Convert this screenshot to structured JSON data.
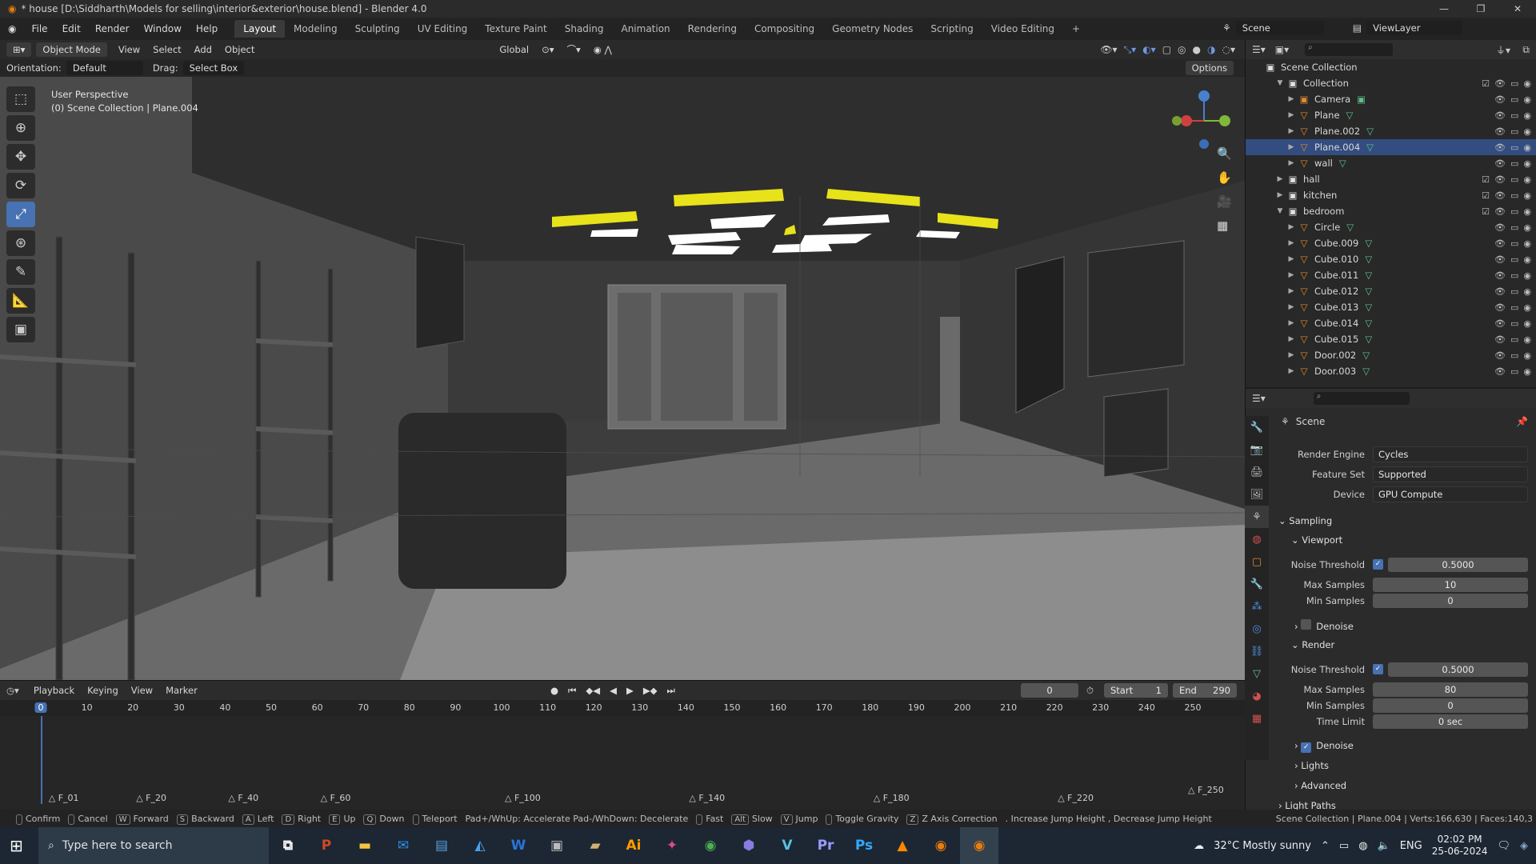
{
  "window": {
    "title": "* house [D:\\Siddharth\\Models for selling\\interior&exterior\\house.blend] - Blender 4.0"
  },
  "menu": {
    "items": [
      "File",
      "Edit",
      "Render",
      "Window",
      "Help"
    ]
  },
  "workspaces": [
    "Layout",
    "Modeling",
    "Sculpting",
    "UV Editing",
    "Texture Paint",
    "Shading",
    "Animation",
    "Rendering",
    "Compositing",
    "Geometry Nodes",
    "Scripting",
    "Video Editing"
  ],
  "active_workspace": "Layout",
  "scene_selector": {
    "scene": "Scene",
    "view_layer": "ViewLayer"
  },
  "viewport_header": {
    "mode": "Object Mode",
    "menus": [
      "View",
      "Select",
      "Add",
      "Object"
    ],
    "transform": "Global"
  },
  "tool_options": {
    "orientation_label": "Orientation:",
    "orientation": "Default",
    "drag_label": "Drag:",
    "drag": "Select Box",
    "options": "Options"
  },
  "viewport_info": {
    "line1": "User Perspective",
    "line2": "(0) Scene Collection | Plane.004"
  },
  "outliner": {
    "root": "Scene Collection",
    "rows": [
      {
        "name": "Collection",
        "indent": 1,
        "type": "collection",
        "open": true
      },
      {
        "name": "Camera",
        "indent": 2,
        "type": "camera"
      },
      {
        "name": "Plane",
        "indent": 2,
        "type": "mesh"
      },
      {
        "name": "Plane.002",
        "indent": 2,
        "type": "mesh"
      },
      {
        "name": "Plane.004",
        "indent": 2,
        "type": "mesh",
        "selected": true
      },
      {
        "name": "wall",
        "indent": 2,
        "type": "mesh"
      },
      {
        "name": "hall",
        "indent": 1,
        "type": "collection"
      },
      {
        "name": "kitchen",
        "indent": 1,
        "type": "collection"
      },
      {
        "name": "bedroom",
        "indent": 1,
        "type": "collection",
        "open": true
      },
      {
        "name": "Circle",
        "indent": 2,
        "type": "mesh"
      },
      {
        "name": "Cube.009",
        "indent": 2,
        "type": "mesh"
      },
      {
        "name": "Cube.010",
        "indent": 2,
        "type": "mesh"
      },
      {
        "name": "Cube.011",
        "indent": 2,
        "type": "mesh"
      },
      {
        "name": "Cube.012",
        "indent": 2,
        "type": "mesh"
      },
      {
        "name": "Cube.013",
        "indent": 2,
        "type": "mesh"
      },
      {
        "name": "Cube.014",
        "indent": 2,
        "type": "mesh"
      },
      {
        "name": "Cube.015",
        "indent": 2,
        "type": "mesh"
      },
      {
        "name": "Door.002",
        "indent": 2,
        "type": "mesh"
      },
      {
        "name": "Door.003",
        "indent": 2,
        "type": "mesh"
      }
    ]
  },
  "properties": {
    "context": "Scene",
    "render_engine_label": "Render Engine",
    "render_engine": "Cycles",
    "feature_set_label": "Feature Set",
    "feature_set": "Supported",
    "device_label": "Device",
    "device": "GPU Compute",
    "sampling": "Sampling",
    "viewport": "Viewport",
    "noise_threshold_label": "Noise Threshold",
    "vp_noise": "0.5000",
    "max_samples_label": "Max Samples",
    "vp_max": "10",
    "min_samples_label": "Min Samples",
    "vp_min": "0",
    "denoise": "Denoise",
    "render": "Render",
    "r_noise": "0.5000",
    "r_max": "80",
    "r_min": "0",
    "time_limit_label": "Time Limit",
    "r_time": "0 sec",
    "lights": "Lights",
    "advanced": "Advanced",
    "light_paths": "Light Paths"
  },
  "timeline": {
    "menus": [
      "Playback",
      "Keying",
      "View",
      "Marker"
    ],
    "current_frame": "0",
    "start_label": "Start",
    "start": "1",
    "end_label": "End",
    "end": "290",
    "ticks": [
      "0",
      "10",
      "20",
      "30",
      "40",
      "50",
      "60",
      "70",
      "80",
      "90",
      "100",
      "110",
      "120",
      "130",
      "140",
      "150",
      "160",
      "170",
      "180",
      "190",
      "200",
      "210",
      "220",
      "230",
      "240",
      "250"
    ],
    "markers": [
      "F_01",
      "F_20",
      "F_40",
      "F_60",
      "F_100",
      "F_140",
      "F_180",
      "F_220",
      "F_250"
    ]
  },
  "statusbar": {
    "items": [
      [
        "",
        "Confirm"
      ],
      [
        "",
        "Cancel"
      ],
      [
        "W",
        "Forward"
      ],
      [
        "S",
        "Backward"
      ],
      [
        "A",
        "Left"
      ],
      [
        "D",
        "Right"
      ],
      [
        "E",
        "Up"
      ],
      [
        "Q",
        "Down"
      ],
      [
        "",
        "Teleport"
      ]
    ],
    "extra": "Pad+/WhUp: Accelerate  Pad-/WhDown: Decelerate",
    "items2": [
      [
        "",
        "Fast"
      ],
      [
        "Alt",
        "Slow"
      ],
      [
        "V",
        "Jump"
      ],
      [
        "",
        "Toggle Gravity"
      ],
      [
        "Z",
        "Z Axis Correction"
      ]
    ],
    "extra2": ". Increase Jump Height  , Decrease Jump Height",
    "right": "Scene Collection | Plane.004 | Verts:166,630 | Faces:140,3"
  },
  "taskbar": {
    "search_placeholder": "Type here to search",
    "weather": "32°C  Mostly sunny",
    "lang": "ENG",
    "time": "02:02 PM",
    "date": "25-06-2024"
  }
}
